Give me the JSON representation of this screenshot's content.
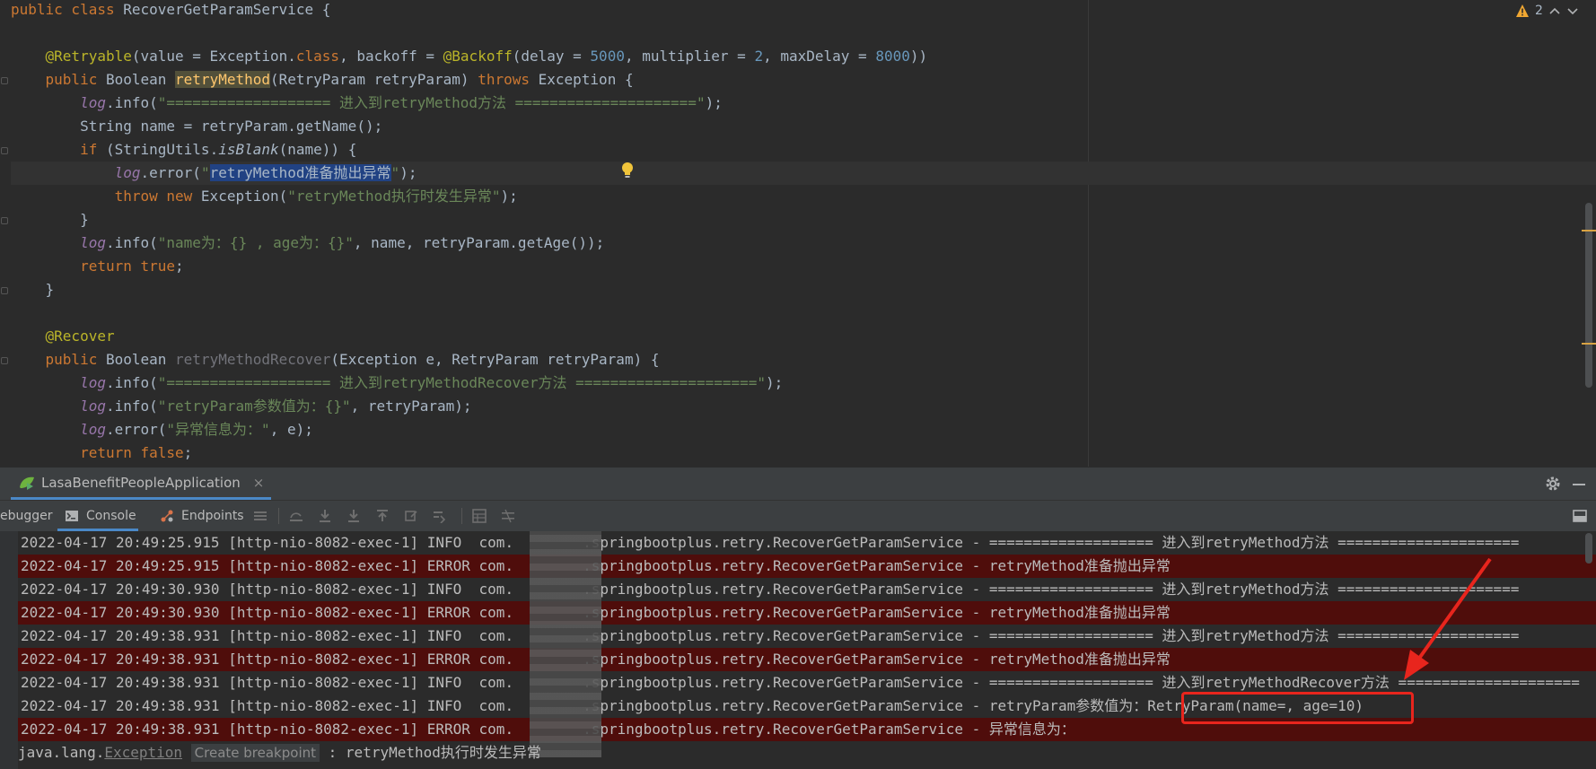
{
  "editor": {
    "warning_count": "2",
    "code_lines": [
      [
        [
          "kw",
          "public class "
        ],
        [
          "t",
          "RecoverGetParamService {"
        ]
      ],
      [],
      [
        [
          "t",
          "    "
        ],
        [
          "an",
          "@Retryable"
        ],
        [
          "t",
          "(value = Exception."
        ],
        [
          "kw",
          "class"
        ],
        [
          "t",
          ", backoff = "
        ],
        [
          "an",
          "@Backoff"
        ],
        [
          "t",
          "(delay = "
        ],
        [
          "num",
          "5000"
        ],
        [
          "t",
          ", multiplier = "
        ],
        [
          "num",
          "2"
        ],
        [
          "t",
          ", maxDelay = "
        ],
        [
          "num",
          "8000"
        ],
        [
          "t",
          "))"
        ]
      ],
      [
        [
          "t",
          "    "
        ],
        [
          "kw",
          "public "
        ],
        [
          "t",
          "Boolean "
        ],
        [
          "mhl",
          "retryMethod"
        ],
        [
          "t",
          "(RetryParam retryParam) "
        ],
        [
          "kw",
          "throws "
        ],
        [
          "t",
          "Exception {"
        ]
      ],
      [
        [
          "t",
          "        "
        ],
        [
          "fld",
          "log"
        ],
        [
          "t",
          ".info("
        ],
        [
          "str",
          "\"=================== 进入到retryMethod方法 =====================\""
        ],
        [
          "t",
          ");"
        ]
      ],
      [
        [
          "t",
          "        String name = retryParam.getName();"
        ]
      ],
      [
        [
          "t",
          "        "
        ],
        [
          "kw",
          "if "
        ],
        [
          "t",
          "(StringUtils."
        ],
        [
          "ital",
          "isBlank"
        ],
        [
          "t",
          "(name)) {"
        ]
      ],
      [
        [
          "t",
          "            "
        ],
        [
          "fld",
          "log"
        ],
        [
          "t",
          ".error("
        ],
        [
          "str",
          "\""
        ],
        [
          "sel",
          "retryMethod准备抛出异常"
        ],
        [
          "str",
          "\""
        ],
        [
          "t",
          ");"
        ]
      ],
      [
        [
          "t",
          "            "
        ],
        [
          "kw",
          "throw new "
        ],
        [
          "t",
          "Exception("
        ],
        [
          "str",
          "\"retryMethod执行时发生异常\""
        ],
        [
          "t",
          ");"
        ]
      ],
      [
        [
          "t",
          "        }"
        ]
      ],
      [
        [
          "t",
          "        "
        ],
        [
          "fld",
          "log"
        ],
        [
          "t",
          ".info("
        ],
        [
          "str",
          "\"name为：{} , age为：{}\""
        ],
        [
          "t",
          ", name, retryParam.getAge());"
        ]
      ],
      [
        [
          "t",
          "        "
        ],
        [
          "kw",
          "return true"
        ],
        [
          "t",
          ";"
        ]
      ],
      [
        [
          "t",
          "    }"
        ]
      ],
      [],
      [
        [
          "t",
          "    "
        ],
        [
          "an",
          "@Recover"
        ]
      ],
      [
        [
          "t",
          "    "
        ],
        [
          "kw",
          "public "
        ],
        [
          "t",
          "Boolean "
        ],
        [
          "unused",
          "retryMethodRecover"
        ],
        [
          "t",
          "(Exception e, RetryParam retryParam) {"
        ]
      ],
      [
        [
          "t",
          "        "
        ],
        [
          "fld",
          "log"
        ],
        [
          "t",
          ".info("
        ],
        [
          "str",
          "\"=================== 进入到retryMethodRecover方法 =====================\""
        ],
        [
          "t",
          ");"
        ]
      ],
      [
        [
          "t",
          "        "
        ],
        [
          "fld",
          "log"
        ],
        [
          "t",
          ".info("
        ],
        [
          "str",
          "\"retryParam参数值为：{}\""
        ],
        [
          "t",
          ", retryParam);"
        ]
      ],
      [
        [
          "t",
          "        "
        ],
        [
          "fld",
          "log"
        ],
        [
          "t",
          ".error("
        ],
        [
          "str",
          "\"异常信息为：\""
        ],
        [
          "t",
          ", e);"
        ]
      ],
      [
        [
          "t",
          "        "
        ],
        [
          "kw",
          "return false"
        ],
        [
          "t",
          ";"
        ]
      ]
    ]
  },
  "run_panel": {
    "tab_label": "LasaBenefitPeopleApplication",
    "tab_close": "×",
    "debugger_label": "ebugger",
    "console_label": "Console",
    "endpoints_label": "Endpoints"
  },
  "console": {
    "lines": [
      {
        "level": "info",
        "text": "2022-04-17 20:49:25.915 [http-nio-8082-exec-1] INFO  com.        .springbootplus.retry.RecoverGetParamService - =================== 进入到retryMethod方法 ====================="
      },
      {
        "level": "error",
        "text": "2022-04-17 20:49:25.915 [http-nio-8082-exec-1] ERROR com.        .springbootplus.retry.RecoverGetParamService - retryMethod准备抛出异常"
      },
      {
        "level": "info",
        "text": "2022-04-17 20:49:30.930 [http-nio-8082-exec-1] INFO  com.        .springbootplus.retry.RecoverGetParamService - =================== 进入到retryMethod方法 ====================="
      },
      {
        "level": "error",
        "text": "2022-04-17 20:49:30.930 [http-nio-8082-exec-1] ERROR com.        .springbootplus.retry.RecoverGetParamService - retryMethod准备抛出异常"
      },
      {
        "level": "info",
        "text": "2022-04-17 20:49:38.931 [http-nio-8082-exec-1] INFO  com.        .springbootplus.retry.RecoverGetParamService - =================== 进入到retryMethod方法 ====================="
      },
      {
        "level": "error",
        "text": "2022-04-17 20:49:38.931 [http-nio-8082-exec-1] ERROR com.        .springbootplus.retry.RecoverGetParamService - retryMethod准备抛出异常"
      },
      {
        "level": "info",
        "text": "2022-04-17 20:49:38.931 [http-nio-8082-exec-1] INFO  com.        .springbootplus.retry.RecoverGetParamService - =================== 进入到retryMethodRecover方法 ====================="
      },
      {
        "level": "info",
        "text": "2022-04-17 20:49:38.931 [http-nio-8082-exec-1] INFO  com.        .springbootplus.retry.RecoverGetParamService - retryParam参数值为：RetryParam(name=, age=10)"
      },
      {
        "level": "error",
        "text": "2022-04-17 20:49:38.931 [http-nio-8082-exec-1] ERROR com.        .springbootplus.retry.RecoverGetParamService - 异常信息为："
      }
    ],
    "exception_prefix": "java.lang.",
    "exception_class": "Exception",
    "breakpoint_hint": "Create breakpoint",
    "exception_message": ": retryMethod执行时发生异常"
  },
  "colors": {
    "error_row": "#4f0d0b",
    "annotation": "#e8251d",
    "accent": "#4a88c7"
  }
}
